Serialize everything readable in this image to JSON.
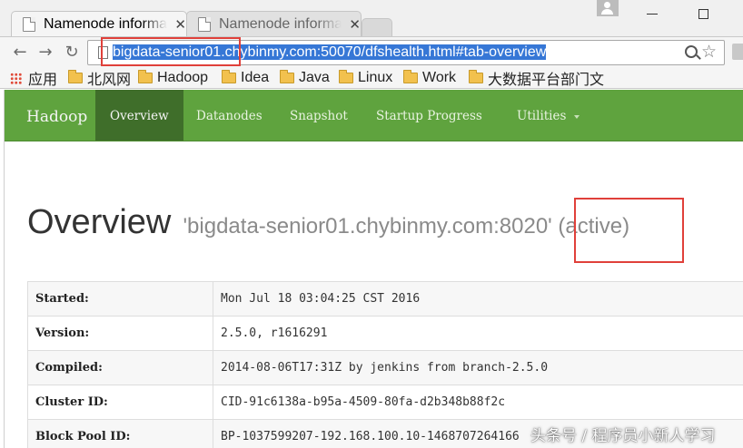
{
  "browser": {
    "tabs": [
      {
        "title": "Namenode information"
      },
      {
        "title": "Namenode information"
      }
    ],
    "url_selected": "bigdata-senior01.chybinmy.com:50070/dfshealth.html#tab-overview",
    "bookmarks": [
      "应用",
      "北风网",
      "Hadoop",
      "Idea",
      "Java",
      "Linux",
      "Work",
      "大数据平台部门文"
    ]
  },
  "nav": {
    "brand": "Hadoop",
    "items": [
      "Overview",
      "Datanodes",
      "Snapshot",
      "Startup Progress",
      "Utilities"
    ]
  },
  "overview": {
    "heading": "Overview",
    "host": "'bigdata-senior01.chybinmy.com:8020'",
    "state": "(active)"
  },
  "info_table": [
    {
      "key": "Started:",
      "value": "Mon Jul 18 03:04:25 CST 2016"
    },
    {
      "key": "Version:",
      "value": "2.5.0, r1616291"
    },
    {
      "key": "Compiled:",
      "value": "2014-08-06T17:31Z by jenkins from branch-2.5.0"
    },
    {
      "key": "Cluster ID:",
      "value": "CID-91c6138a-b95a-4509-80fa-d2b348b88f2c"
    },
    {
      "key": "Block Pool ID:",
      "value": "BP-1037599207-192.168.100.10-1468707264166"
    }
  ],
  "watermark": "头条号 / 程序员小新人学习",
  "colors": {
    "navbar": "#5fa33e",
    "navbar_active": "#3f6e2a",
    "highlight_box": "#e0403a",
    "url_selection": "#3677d6"
  }
}
